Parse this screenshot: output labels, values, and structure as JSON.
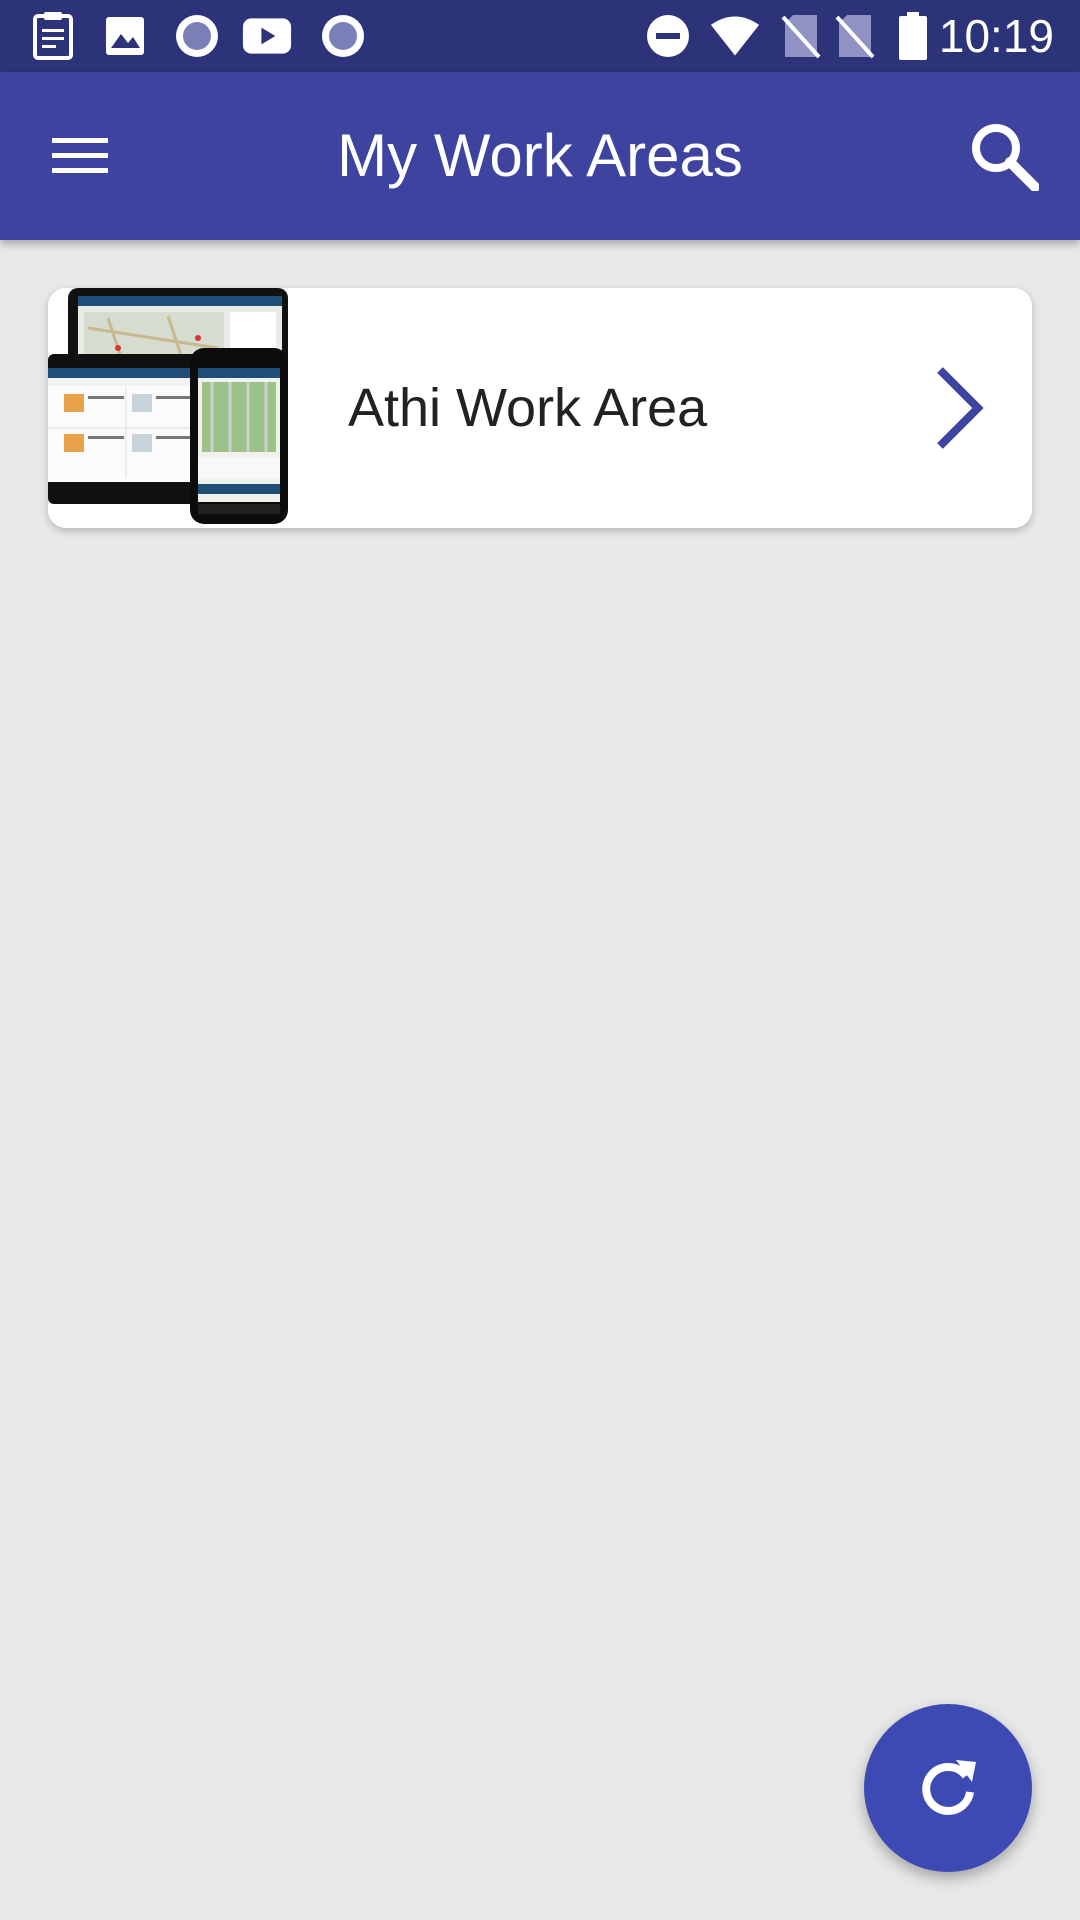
{
  "status_bar": {
    "time": "10:19",
    "left_icons": [
      "clipboard-icon",
      "image-icon",
      "radio-icon",
      "youtube-icon",
      "radio-icon"
    ],
    "right_icons": [
      "do-not-disturb-icon",
      "wifi-icon",
      "no-sim-icon",
      "no-sim-icon",
      "battery-icon"
    ]
  },
  "app_bar": {
    "title": "My Work Areas",
    "background_color": "#3d439f",
    "menu_icon": "menu-icon",
    "search_icon": "search-icon"
  },
  "work_areas": [
    {
      "name": "Athi Work Area",
      "thumbnail": "devices-map-thumbnail",
      "chevron_icon": "chevron-right-icon"
    }
  ],
  "fab": {
    "icon": "refresh-icon",
    "color": "#3e4ab4"
  },
  "colors": {
    "accent": "#3d439f",
    "status_bar": "#2d3379",
    "background": "#e8e8e9"
  }
}
